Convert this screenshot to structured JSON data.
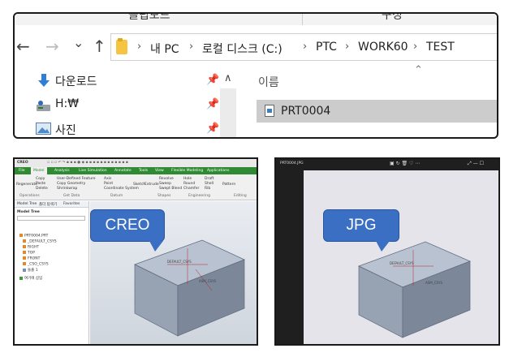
{
  "explorer": {
    "ribbon": {
      "left_label": "클립보드",
      "right_label": "구성"
    },
    "nav": {
      "back_icon": "←",
      "forward_icon": "→",
      "recent_icon": "⌄",
      "up_icon": "↑"
    },
    "breadcrumb": [
      "내 PC",
      "로컬 디스크 (C:)",
      "PTC",
      "WORK60",
      "TEST"
    ],
    "sidebar": [
      {
        "label": "다운로드",
        "icon": "download-icon"
      },
      {
        "label": "H:₩",
        "icon": "drive-icon"
      },
      {
        "label": "사진",
        "icon": "pictures-icon"
      }
    ],
    "column_header": "이름",
    "file": {
      "name": "PRT0004",
      "icon": "creo-part-file-icon"
    }
  },
  "creo": {
    "callout": "CREO",
    "app_logo": "CREO",
    "tabs": [
      "File",
      "Model",
      "Analysis",
      "Live Simulation",
      "Annotate",
      "Tools",
      "View",
      "Flexible Modeling",
      "Applications"
    ],
    "ribbon_items": [
      "User-Defined Feature",
      "Copy Geometry",
      "Shrinkwrap",
      "Axis",
      "Point",
      "Coordinate System",
      "Sketch",
      "Extrude",
      "Revolve",
      "Sweep",
      "Swept Blend",
      "Hole",
      "Round",
      "Chamfer",
      "Draft",
      "Shell",
      "Rib",
      "Pattern"
    ],
    "ribbon_groups": [
      "Operations",
      "Get Data",
      "Datum",
      "Shapes",
      "Engineering",
      "Editing"
    ],
    "ribbon_left": [
      "Regenerate",
      "Copy",
      "Paste",
      "Delete"
    ],
    "pane_tabs": [
      "Model Tree",
      "폴더 탐색기",
      "Favorites"
    ],
    "tree_header": "Model Tree",
    "tree_items": [
      "PRT0004.PRT",
      "_DEFAULT_CSYS",
      "RIGHT",
      "TOP",
      "FRONT",
      "_CSO_CSYS",
      "돌출 1",
      "여기에 삽입"
    ],
    "model_labels": [
      "DEFAULT_CSYS",
      "ASM_CSYS"
    ]
  },
  "jpg": {
    "callout": "JPG",
    "title": "PRT0004.JPG",
    "model_labels": [
      "DEFAULT_CSYS",
      "ASM_CSYS"
    ]
  },
  "colors": {
    "callout_fill": "#3a6fc4",
    "creo_tab_bar": "#2f8a33",
    "file_row_selected": "#cccccc",
    "model_top": "#b8c2d0",
    "model_front": "#97a2b3",
    "model_side": "#7c8799"
  }
}
